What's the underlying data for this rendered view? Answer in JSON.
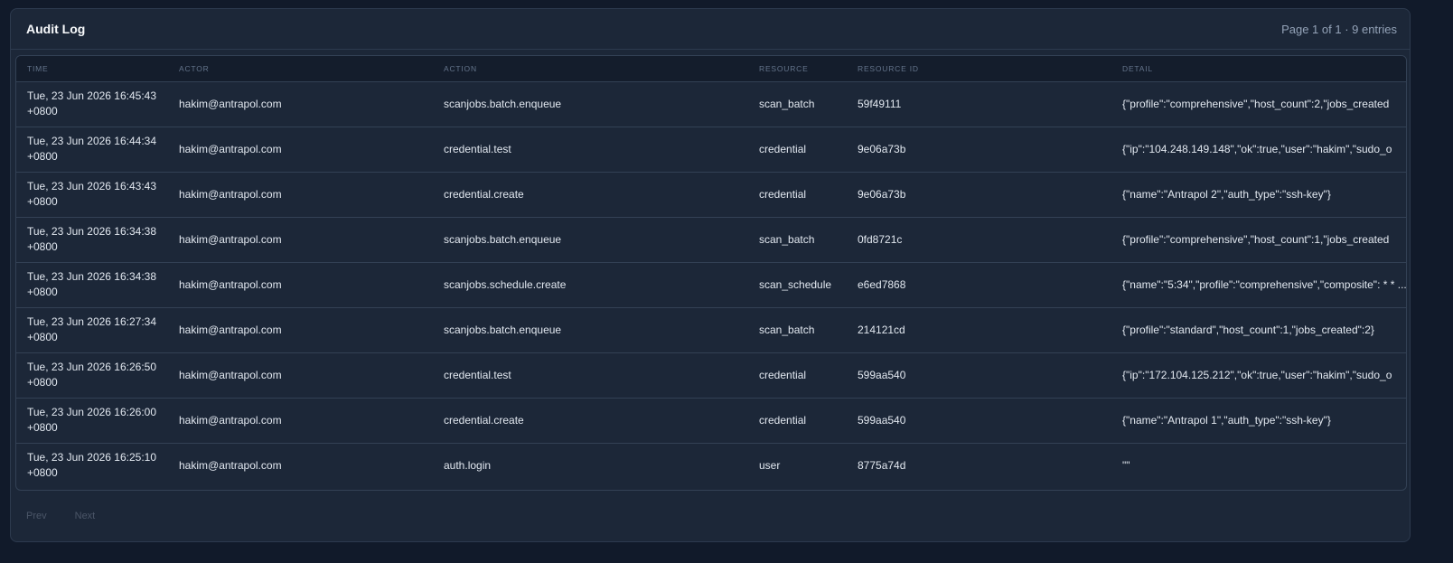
{
  "header": {
    "title": "Audit Log",
    "page_info": "Page 1 of 1 · 9 entries"
  },
  "table": {
    "columns": [
      "TIME",
      "ACTOR",
      "ACTION",
      "RESOURCE",
      "RESOURCE ID",
      "DETAIL"
    ],
    "rows": [
      {
        "time": "Tue, 23 Jun 2026 16:45:43 +0800",
        "actor": "hakim@antrapol.com",
        "action": "scanjobs.batch.enqueue",
        "resource": "scan_batch",
        "resource_id": "59f49111",
        "detail": "{\"profile\":\"comprehensive\",\"host_count\":2,\"jobs_created"
      },
      {
        "time": "Tue, 23 Jun 2026 16:44:34 +0800",
        "actor": "hakim@antrapol.com",
        "action": "credential.test",
        "resource": "credential",
        "resource_id": "9e06a73b",
        "detail": "{\"ip\":\"104.248.149.148\",\"ok\":true,\"user\":\"hakim\",\"sudo_o"
      },
      {
        "time": "Tue, 23 Jun 2026 16:43:43 +0800",
        "actor": "hakim@antrapol.com",
        "action": "credential.create",
        "resource": "credential",
        "resource_id": "9e06a73b",
        "detail": "{\"name\":\"Antrapol 2\",\"auth_type\":\"ssh-key\"}"
      },
      {
        "time": "Tue, 23 Jun 2026 16:34:38 +0800",
        "actor": "hakim@antrapol.com",
        "action": "scanjobs.batch.enqueue",
        "resource": "scan_batch",
        "resource_id": "0fd8721c",
        "detail": "{\"profile\":\"comprehensive\",\"host_count\":1,\"jobs_created"
      },
      {
        "time": "Tue, 23 Jun 2026 16:34:38 +0800",
        "actor": "hakim@antrapol.com",
        "action": "scanjobs.schedule.create",
        "resource": "scan_schedule",
        "resource_id": "e6ed7868",
        "detail": "{\"name\":\"5:34\",\"profile\":\"comprehensive\",\"composite\": * * ..."
      },
      {
        "time": "Tue, 23 Jun 2026 16:27:34 +0800",
        "actor": "hakim@antrapol.com",
        "action": "scanjobs.batch.enqueue",
        "resource": "scan_batch",
        "resource_id": "214121cd",
        "detail": "{\"profile\":\"standard\",\"host_count\":1,\"jobs_created\":2}"
      },
      {
        "time": "Tue, 23 Jun 2026 16:26:50 +0800",
        "actor": "hakim@antrapol.com",
        "action": "credential.test",
        "resource": "credential",
        "resource_id": "599aa540",
        "detail": "{\"ip\":\"172.104.125.212\",\"ok\":true,\"user\":\"hakim\",\"sudo_o"
      },
      {
        "time": "Tue, 23 Jun 2026 16:26:00 +0800",
        "actor": "hakim@antrapol.com",
        "action": "credential.create",
        "resource": "credential",
        "resource_id": "599aa540",
        "detail": "{\"name\":\"Antrapol 1\",\"auth_type\":\"ssh-key\"}"
      },
      {
        "time": "Tue, 23 Jun 2026 16:25:10 +0800",
        "actor": "hakim@antrapol.com",
        "action": "auth.login",
        "resource": "user",
        "resource_id": "8775a74d",
        "detail": "\"\""
      }
    ]
  },
  "pager": {
    "prev_label": "Prev",
    "next_label": "Next"
  }
}
